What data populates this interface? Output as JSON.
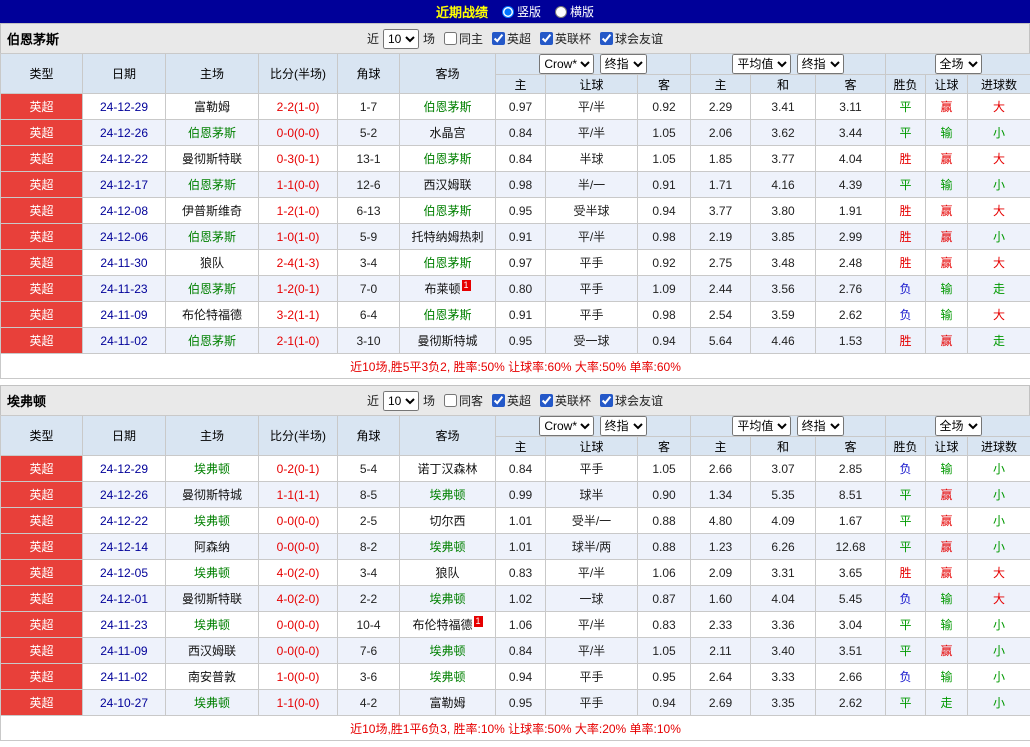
{
  "topbar": {
    "title": "近期战绩",
    "layout_options": [
      {
        "label": "竖版",
        "selected": true
      },
      {
        "label": "横版",
        "selected": false
      }
    ]
  },
  "colors": {
    "topbar_bg": "#000099",
    "title": "#ffff00",
    "league_bg": "#e8403a",
    "date": "#000099",
    "score": "#e60000",
    "focus_team": "#008000",
    "win": "#e60000",
    "draw": "#009900",
    "lose": "#1414cc",
    "header_bg": "#d9e5f2",
    "row_alt_bg": "#eef2fb",
    "controls_bg": "#e9e9e9",
    "summary": "#e60000"
  },
  "result_styles": {
    "胜": "red",
    "平": "green",
    "负": "blue",
    "赢": "red",
    "输": "green",
    "走": "green",
    "大": "red",
    "小": "green"
  },
  "sections": [
    {
      "team": "伯恩茅斯",
      "controls": {
        "near_label": "近",
        "count": "10",
        "games_label": "场",
        "same_label": "同主",
        "same_checked": false,
        "leagues": [
          {
            "label": "英超",
            "checked": true
          },
          {
            "label": "英联杯",
            "checked": true
          },
          {
            "label": "球会友谊",
            "checked": true
          }
        ],
        "odds_source": "Crow*",
        "odds_kind": "终指",
        "avg_label": "平均值",
        "avg_kind": "终指",
        "scope": "全场"
      },
      "header": {
        "type": "类型",
        "date": "日期",
        "home": "主场",
        "score": "比分(半场)",
        "corner": "角球",
        "away": "客场",
        "sub": [
          "主",
          "让球",
          "客",
          "主",
          "和",
          "客",
          "胜负",
          "让球",
          "进球数"
        ]
      },
      "rows": [
        {
          "league": "英超",
          "date": "24-12-29",
          "home": "富勒姆",
          "home_focus": false,
          "score": "2-2(1-0)",
          "corner": "1-7",
          "away": "伯恩茅斯",
          "away_focus": true,
          "odds_home": "0.97",
          "handicap": "平/半",
          "odds_away": "0.92",
          "avg_home": "2.29",
          "avg_draw": "3.41",
          "avg_away": "3.11",
          "result": "平",
          "handicap_result": "赢",
          "goals_result": "大"
        },
        {
          "league": "英超",
          "date": "24-12-26",
          "home": "伯恩茅斯",
          "home_focus": true,
          "score": "0-0(0-0)",
          "corner": "5-2",
          "away": "水晶宫",
          "away_focus": false,
          "odds_home": "0.84",
          "handicap": "平/半",
          "odds_away": "1.05",
          "avg_home": "2.06",
          "avg_draw": "3.62",
          "avg_away": "3.44",
          "result": "平",
          "handicap_result": "输",
          "goals_result": "小"
        },
        {
          "league": "英超",
          "date": "24-12-22",
          "home": "曼彻斯特联",
          "home_focus": false,
          "score": "0-3(0-1)",
          "corner": "13-1",
          "away": "伯恩茅斯",
          "away_focus": true,
          "odds_home": "0.84",
          "handicap": "半球",
          "odds_away": "1.05",
          "avg_home": "1.85",
          "avg_draw": "3.77",
          "avg_away": "4.04",
          "result": "胜",
          "handicap_result": "赢",
          "goals_result": "大"
        },
        {
          "league": "英超",
          "date": "24-12-17",
          "home": "伯恩茅斯",
          "home_focus": true,
          "score": "1-1(0-0)",
          "corner": "12-6",
          "away": "西汉姆联",
          "away_focus": false,
          "odds_home": "0.98",
          "handicap": "半/一",
          "odds_away": "0.91",
          "avg_home": "1.71",
          "avg_draw": "4.16",
          "avg_away": "4.39",
          "result": "平",
          "handicap_result": "输",
          "goals_result": "小"
        },
        {
          "league": "英超",
          "date": "24-12-08",
          "home": "伊普斯维奇",
          "home_focus": false,
          "score": "1-2(1-0)",
          "corner": "6-13",
          "away": "伯恩茅斯",
          "away_focus": true,
          "odds_home": "0.95",
          "handicap": "受半球",
          "odds_away": "0.94",
          "avg_home": "3.77",
          "avg_draw": "3.80",
          "avg_away": "1.91",
          "result": "胜",
          "handicap_result": "赢",
          "goals_result": "大"
        },
        {
          "league": "英超",
          "date": "24-12-06",
          "home": "伯恩茅斯",
          "home_focus": true,
          "score": "1-0(1-0)",
          "corner": "5-9",
          "away": "托特纳姆热刺",
          "away_focus": false,
          "odds_home": "0.91",
          "handicap": "平/半",
          "odds_away": "0.98",
          "avg_home": "2.19",
          "avg_draw": "3.85",
          "avg_away": "2.99",
          "result": "胜",
          "handicap_result": "赢",
          "goals_result": "小"
        },
        {
          "league": "英超",
          "date": "24-11-30",
          "home": "狼队",
          "home_focus": false,
          "score": "2-4(1-3)",
          "corner": "3-4",
          "away": "伯恩茅斯",
          "away_focus": true,
          "odds_home": "0.97",
          "handicap": "平手",
          "odds_away": "0.92",
          "avg_home": "2.75",
          "avg_draw": "3.48",
          "avg_away": "2.48",
          "result": "胜",
          "handicap_result": "赢",
          "goals_result": "大"
        },
        {
          "league": "英超",
          "date": "24-11-23",
          "home": "伯恩茅斯",
          "home_focus": true,
          "score": "1-2(0-1)",
          "corner": "7-0",
          "away": "布莱顿",
          "away_focus": false,
          "away_badge": "1",
          "odds_home": "0.80",
          "handicap": "平手",
          "odds_away": "1.09",
          "avg_home": "2.44",
          "avg_draw": "3.56",
          "avg_away": "2.76",
          "result": "负",
          "handicap_result": "输",
          "goals_result": "走"
        },
        {
          "league": "英超",
          "date": "24-11-09",
          "home": "布伦特福德",
          "home_focus": false,
          "score": "3-2(1-1)",
          "corner": "6-4",
          "away": "伯恩茅斯",
          "away_focus": true,
          "odds_home": "0.91",
          "handicap": "平手",
          "odds_away": "0.98",
          "avg_home": "2.54",
          "avg_draw": "3.59",
          "avg_away": "2.62",
          "result": "负",
          "handicap_result": "输",
          "goals_result": "大"
        },
        {
          "league": "英超",
          "date": "24-11-02",
          "home": "伯恩茅斯",
          "home_focus": true,
          "score": "2-1(1-0)",
          "corner": "3-10",
          "away": "曼彻斯特城",
          "away_focus": false,
          "odds_home": "0.95",
          "handicap": "受一球",
          "odds_away": "0.94",
          "avg_home": "5.64",
          "avg_draw": "4.46",
          "avg_away": "1.53",
          "result": "胜",
          "handicap_result": "赢",
          "goals_result": "走"
        }
      ],
      "summary": "近10场,胜5平3负2, 胜率:50% 让球率:60% 大率:50% 单率:60%"
    },
    {
      "team": "埃弗顿",
      "controls": {
        "near_label": "近",
        "count": "10",
        "games_label": "场",
        "same_label": "同客",
        "same_checked": false,
        "leagues": [
          {
            "label": "英超",
            "checked": true
          },
          {
            "label": "英联杯",
            "checked": true
          },
          {
            "label": "球会友谊",
            "checked": true
          }
        ],
        "odds_source": "Crow*",
        "odds_kind": "终指",
        "avg_label": "平均值",
        "avg_kind": "终指",
        "scope": "全场"
      },
      "header": {
        "type": "类型",
        "date": "日期",
        "home": "主场",
        "score": "比分(半场)",
        "corner": "角球",
        "away": "客场",
        "sub": [
          "主",
          "让球",
          "客",
          "主",
          "和",
          "客",
          "胜负",
          "让球",
          "进球数"
        ]
      },
      "rows": [
        {
          "league": "英超",
          "date": "24-12-29",
          "home": "埃弗顿",
          "home_focus": true,
          "score": "0-2(0-1)",
          "corner": "5-4",
          "away": "诺丁汉森林",
          "away_focus": false,
          "odds_home": "0.84",
          "handicap": "平手",
          "odds_away": "1.05",
          "avg_home": "2.66",
          "avg_draw": "3.07",
          "avg_away": "2.85",
          "result": "负",
          "handicap_result": "输",
          "goals_result": "小"
        },
        {
          "league": "英超",
          "date": "24-12-26",
          "home": "曼彻斯特城",
          "home_focus": false,
          "score": "1-1(1-1)",
          "corner": "8-5",
          "away": "埃弗顿",
          "away_focus": true,
          "odds_home": "0.99",
          "handicap": "球半",
          "odds_away": "0.90",
          "avg_home": "1.34",
          "avg_draw": "5.35",
          "avg_away": "8.51",
          "result": "平",
          "handicap_result": "赢",
          "goals_result": "小"
        },
        {
          "league": "英超",
          "date": "24-12-22",
          "home": "埃弗顿",
          "home_focus": true,
          "score": "0-0(0-0)",
          "corner": "2-5",
          "away": "切尔西",
          "away_focus": false,
          "odds_home": "1.01",
          "handicap": "受半/一",
          "odds_away": "0.88",
          "avg_home": "4.80",
          "avg_draw": "4.09",
          "avg_away": "1.67",
          "result": "平",
          "handicap_result": "赢",
          "goals_result": "小"
        },
        {
          "league": "英超",
          "date": "24-12-14",
          "home": "阿森纳",
          "home_focus": false,
          "score": "0-0(0-0)",
          "corner": "8-2",
          "away": "埃弗顿",
          "away_focus": true,
          "odds_home": "1.01",
          "handicap": "球半/两",
          "odds_away": "0.88",
          "avg_home": "1.23",
          "avg_draw": "6.26",
          "avg_away": "12.68",
          "result": "平",
          "handicap_result": "赢",
          "goals_result": "小"
        },
        {
          "league": "英超",
          "date": "24-12-05",
          "home": "埃弗顿",
          "home_focus": true,
          "score": "4-0(2-0)",
          "corner": "3-4",
          "away": "狼队",
          "away_focus": false,
          "odds_home": "0.83",
          "handicap": "平/半",
          "odds_away": "1.06",
          "avg_home": "2.09",
          "avg_draw": "3.31",
          "avg_away": "3.65",
          "result": "胜",
          "handicap_result": "赢",
          "goals_result": "大"
        },
        {
          "league": "英超",
          "date": "24-12-01",
          "home": "曼彻斯特联",
          "home_focus": false,
          "score": "4-0(2-0)",
          "corner": "2-2",
          "away": "埃弗顿",
          "away_focus": true,
          "odds_home": "1.02",
          "handicap": "一球",
          "odds_away": "0.87",
          "avg_home": "1.60",
          "avg_draw": "4.04",
          "avg_away": "5.45",
          "result": "负",
          "handicap_result": "输",
          "goals_result": "大"
        },
        {
          "league": "英超",
          "date": "24-11-23",
          "home": "埃弗顿",
          "home_focus": true,
          "score": "0-0(0-0)",
          "corner": "10-4",
          "away": "布伦特福德",
          "away_focus": false,
          "away_badge": "1",
          "odds_home": "1.06",
          "handicap": "平/半",
          "odds_away": "0.83",
          "avg_home": "2.33",
          "avg_draw": "3.36",
          "avg_away": "3.04",
          "result": "平",
          "handicap_result": "输",
          "goals_result": "小"
        },
        {
          "league": "英超",
          "date": "24-11-09",
          "home": "西汉姆联",
          "home_focus": false,
          "score": "0-0(0-0)",
          "corner": "7-6",
          "away": "埃弗顿",
          "away_focus": true,
          "odds_home": "0.84",
          "handicap": "平/半",
          "odds_away": "1.05",
          "avg_home": "2.11",
          "avg_draw": "3.40",
          "avg_away": "3.51",
          "result": "平",
          "handicap_result": "赢",
          "goals_result": "小"
        },
        {
          "league": "英超",
          "date": "24-11-02",
          "home": "南安普敦",
          "home_focus": false,
          "score": "1-0(0-0)",
          "corner": "3-6",
          "away": "埃弗顿",
          "away_focus": true,
          "odds_home": "0.94",
          "handicap": "平手",
          "odds_away": "0.95",
          "avg_home": "2.64",
          "avg_draw": "3.33",
          "avg_away": "2.66",
          "result": "负",
          "handicap_result": "输",
          "goals_result": "小"
        },
        {
          "league": "英超",
          "date": "24-10-27",
          "home": "埃弗顿",
          "home_focus": true,
          "score": "1-1(0-0)",
          "corner": "4-2",
          "away": "富勒姆",
          "away_focus": false,
          "odds_home": "0.95",
          "handicap": "平手",
          "odds_away": "0.94",
          "avg_home": "2.69",
          "avg_draw": "3.35",
          "avg_away": "2.62",
          "result": "平",
          "handicap_result": "走",
          "goals_result": "小"
        }
      ],
      "summary": "近10场,胜1平6负3, 胜率:10% 让球率:50% 大率:20% 单率:10%"
    }
  ]
}
